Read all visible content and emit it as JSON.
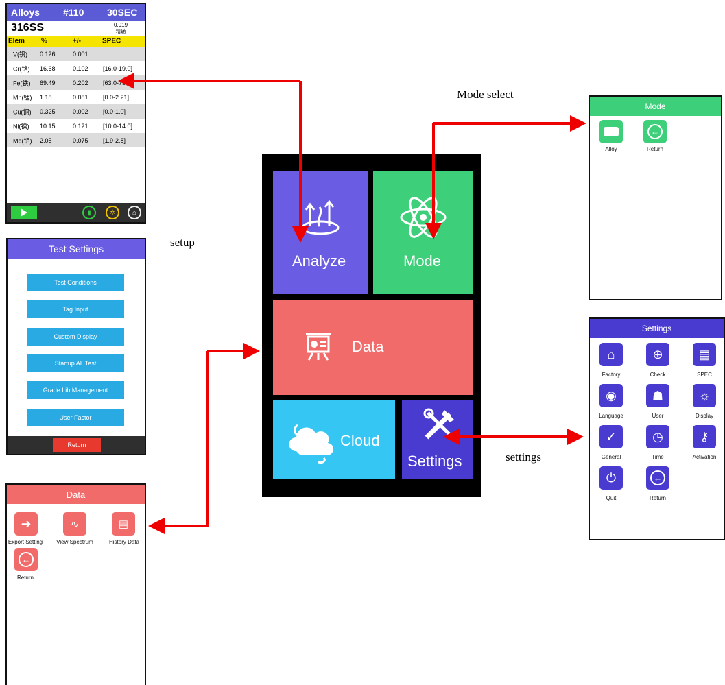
{
  "labels": {
    "mode_select": "Mode select",
    "setup": "setup",
    "settings": "settings"
  },
  "main_menu": {
    "analyze": "Analyze",
    "mode": "Mode",
    "data": "Data",
    "cloud": "Cloud",
    "settings": "Settings"
  },
  "alloy_screen": {
    "title": "Alloys",
    "number": "#110",
    "time": "30SEC",
    "grade": "316SS",
    "match_value": "0.019",
    "match_label": "精确",
    "columns": [
      "Elem",
      "%",
      "+/-",
      "SPEC"
    ],
    "rows": [
      [
        "V(钒)",
        "0.126",
        "0.001",
        ""
      ],
      [
        "Cr(铬)",
        "16.68",
        "0.102",
        "[16.0-19.0]"
      ],
      [
        "Fe(铁)",
        "69.49",
        "0.202",
        "[63.0-73.0]"
      ],
      [
        "Mn(锰)",
        "1.18",
        "0.081",
        "[0.0-2.21]"
      ],
      [
        "Cu(铜)",
        "0.325",
        "0.002",
        "[0.0-1.0]"
      ],
      [
        "Ni(镍)",
        "10.15",
        "0.121",
        "[10.0-14.0]"
      ],
      [
        "Mo(钼)",
        "2.05",
        "0.075",
        "[1.9-2.8]"
      ]
    ]
  },
  "test_settings": {
    "title": "Test Settings",
    "buttons": [
      "Test Conditions",
      "Tag Input",
      "Custom Display",
      "Startup AL Test",
      "Grade Lib Management",
      "User Factor"
    ],
    "return": "Return"
  },
  "data_screen": {
    "title": "Data",
    "items": [
      "Export Setting",
      "View Spectrum",
      "History Data",
      "Return"
    ]
  },
  "mode_screen": {
    "title": "Mode",
    "items": [
      "Alloy",
      "Return"
    ]
  },
  "settings_screen": {
    "title": "Settings",
    "items": [
      "Factory",
      "Check",
      "SPEC",
      "Language",
      "User",
      "Display",
      "General",
      "Time",
      "Activation",
      "Quit",
      "Return"
    ]
  },
  "colors": {
    "analyze": "#6a5ce3",
    "mode": "#3ecf7a",
    "data": "#f26b6b",
    "cloud": "#36c6f4",
    "settings": "#4a3bd0",
    "arrow": "#ee0000",
    "alloy_header": "#5b5bd6",
    "column_header": "#f4e400",
    "ts_button": "#2aaae2",
    "ts_return": "#e8392e"
  }
}
